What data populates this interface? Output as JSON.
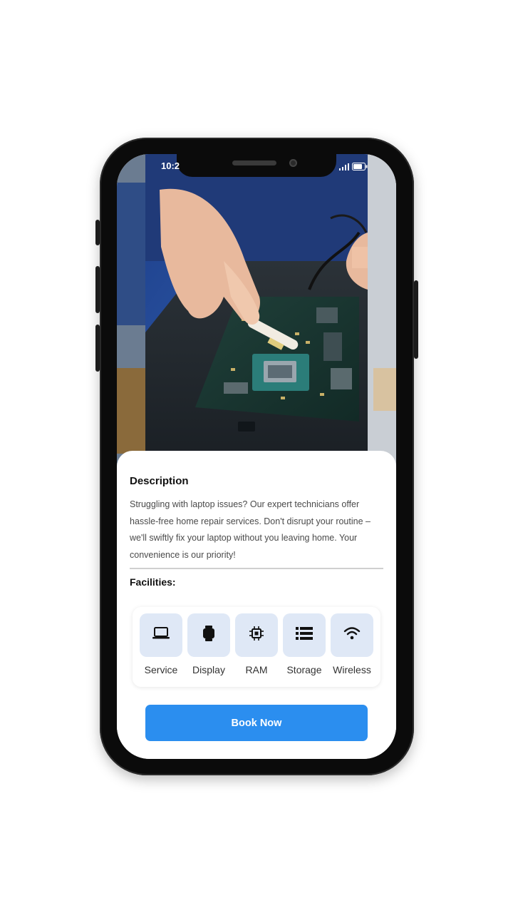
{
  "status_bar": {
    "time": "10:2"
  },
  "description": {
    "title": "Description",
    "body": "Struggling with laptop issues? Our expert technicians offer hassle-free home repair services. Don't disrupt your routine – we'll swiftly fix your laptop without you leaving home. Your convenience is our priority!"
  },
  "facilities": {
    "title": "Facilities:",
    "items": [
      {
        "label": "Service",
        "icon": "laptop-icon"
      },
      {
        "label": "Display",
        "icon": "display-icon"
      },
      {
        "label": "RAM",
        "icon": "chip-icon"
      },
      {
        "label": "Storage",
        "icon": "storage-icon"
      },
      {
        "label": "Wireless",
        "icon": "wifi-icon"
      }
    ]
  },
  "actions": {
    "book_label": "Book Now"
  },
  "colors": {
    "accent": "#2b8eef",
    "icon_tile": "#dfe8f6"
  }
}
